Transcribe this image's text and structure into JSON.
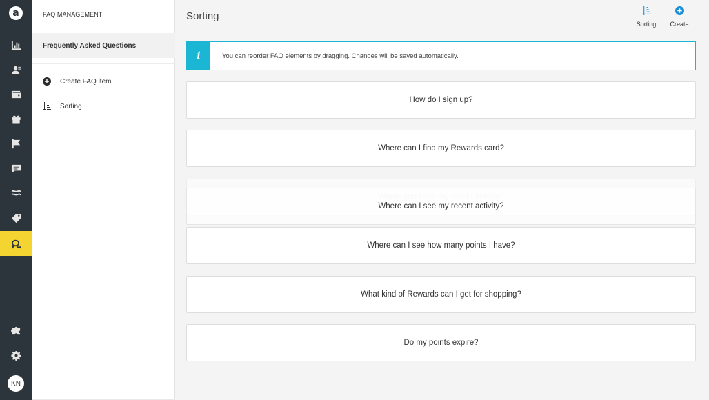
{
  "rail": {
    "logo": "a",
    "avatar_initials": "KN",
    "icons": [
      "dashboard-icon",
      "customers-icon",
      "wallet-icon",
      "gift-icon",
      "flag-icon",
      "chat-icon",
      "waves-icon",
      "tag-icon",
      "faq-icon",
      "puzzle-icon",
      "gear-icon"
    ]
  },
  "subnav": {
    "title": "FAQ MANAGEMENT",
    "selected": "Frequently Asked Questions",
    "items": [
      {
        "label": "Create FAQ item",
        "icon": "plus-circle-icon"
      },
      {
        "label": "Sorting",
        "icon": "sort-icon"
      }
    ]
  },
  "main": {
    "title": "Sorting",
    "actions": [
      {
        "label": "Sorting",
        "icon": "sort-icon"
      },
      {
        "label": "Create",
        "icon": "plus-circle-icon"
      }
    ],
    "info_icon": "i",
    "info_message": "You can reorder FAQ elements by dragging. Changes will be saved automatically.",
    "faqs": [
      "How do I sign up?",
      "Where can I find my Rewards card?",
      "Where can I see my recent activity?",
      "Where can I see how many points I have?",
      "What kind of Rewards can I get for shopping?",
      "Do my points expire?"
    ],
    "dragging_item": "Where can I see my recent activity?"
  },
  "colors": {
    "rail_bg": "#2c353b",
    "accent_active": "#f3d431",
    "info_accent": "#1bb6d4",
    "icon_blue": "#1a8ed6"
  }
}
